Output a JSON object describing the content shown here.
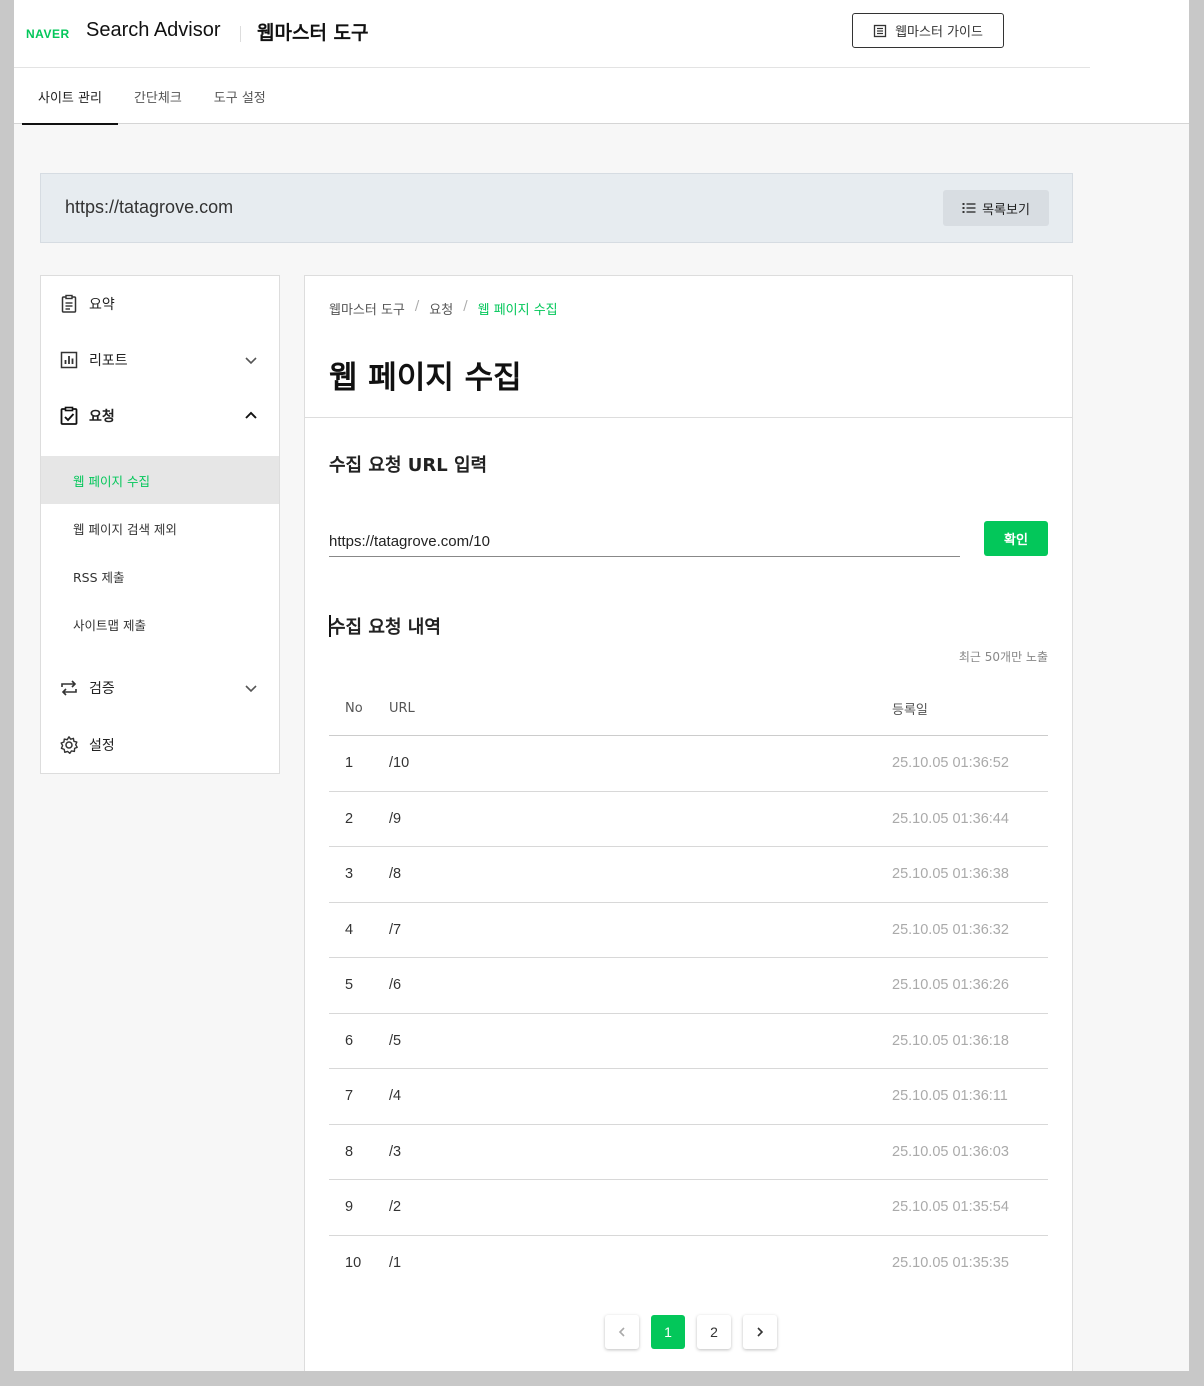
{
  "header": {
    "brand": "NAVER",
    "product": "Search Advisor",
    "section": "웹마스터 도구",
    "guide_label": "웹마스터 가이드",
    "tabs": [
      "사이트 관리",
      "간단체크",
      "도구 설정"
    ]
  },
  "site": {
    "url": "https://tatagrove.com",
    "list_label": "목록보기"
  },
  "sidebar": {
    "items": [
      {
        "label": "요약",
        "icon": "clipboard-icon"
      },
      {
        "label": "리포트",
        "icon": "chart-icon"
      },
      {
        "label": "요청",
        "icon": "clipboard-check-icon"
      },
      {
        "label": "검증",
        "icon": "repeat-icon"
      },
      {
        "label": "설정",
        "icon": "gear-icon"
      }
    ],
    "sub_items": [
      "웹 페이지 수집",
      "웹 페이지 검색 제외",
      "RSS 제출",
      "사이트맵 제출"
    ]
  },
  "main": {
    "breadcrumb": [
      "웹마스터 도구",
      "요청",
      "웹 페이지 수집"
    ],
    "title": "웹 페이지 수집",
    "input_section_title": "수집 요청 URL 입력",
    "input_value": "https://tatagrove.com/10",
    "confirm_label": "확인",
    "history_title": "수집 요청 내역",
    "history_note": "최근 50개만 노출",
    "columns": [
      "No",
      "URL",
      "등록일"
    ],
    "rows": [
      {
        "no": "1",
        "url": "/10",
        "date": "25.10.05 01:36:52"
      },
      {
        "no": "2",
        "url": "/9",
        "date": "25.10.05 01:36:44"
      },
      {
        "no": "3",
        "url": "/8",
        "date": "25.10.05 01:36:38"
      },
      {
        "no": "4",
        "url": "/7",
        "date": "25.10.05 01:36:32"
      },
      {
        "no": "5",
        "url": "/6",
        "date": "25.10.05 01:36:26"
      },
      {
        "no": "6",
        "url": "/5",
        "date": "25.10.05 01:36:18"
      },
      {
        "no": "7",
        "url": "/4",
        "date": "25.10.05 01:36:11"
      },
      {
        "no": "8",
        "url": "/3",
        "date": "25.10.05 01:36:03"
      },
      {
        "no": "9",
        "url": "/2",
        "date": "25.10.05 01:35:54"
      },
      {
        "no": "10",
        "url": "/1",
        "date": "25.10.05 01:35:35"
      }
    ],
    "pages": [
      "1",
      "2"
    ],
    "current_page": "1"
  },
  "colors": {
    "accent": "#03c75a",
    "site_bar": "#e7ecf0"
  }
}
